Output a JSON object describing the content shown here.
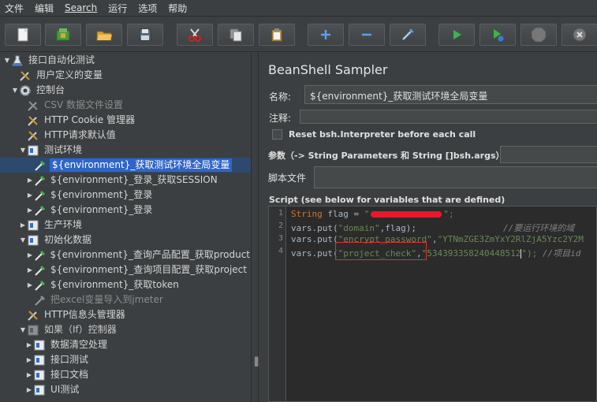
{
  "menu": {
    "file": "文件",
    "edit": "编辑",
    "search": "Search",
    "run": "运行",
    "options": "选项",
    "help": "帮助"
  },
  "tree": [
    {
      "label": "接口自动化测试"
    },
    {
      "label": "用户定义的变量"
    },
    {
      "label": "控制台"
    },
    {
      "label": "CSV 数据文件设置"
    },
    {
      "label": "HTTP Cookie 管理器"
    },
    {
      "label": "HTTP请求默认值"
    },
    {
      "label": "测试环境"
    },
    {
      "label": "${environment}_获取测试环境全局变量"
    },
    {
      "label": "${environment}_登录_获取SESSION"
    },
    {
      "label": "${environment}_登录"
    },
    {
      "label": "${environment}_登录"
    },
    {
      "label": "生产环境"
    },
    {
      "label": "初始化数据"
    },
    {
      "label": "${environment}_查询产品配置_获取product"
    },
    {
      "label": "${environment}_查询项目配置_获取project"
    },
    {
      "label": "${environment}_获取token"
    },
    {
      "label": "把excel变量导入到jmeter"
    },
    {
      "label": "HTTP信息头管理器"
    },
    {
      "label": "如果（If）控制器"
    },
    {
      "label": "数据清空处理"
    },
    {
      "label": "接口测试"
    },
    {
      "label": "接口文档"
    },
    {
      "label": "UI测试"
    }
  ],
  "panel": {
    "title": "BeanShell Sampler",
    "name_label": "名称:",
    "name_value": "${environment}_获取测试环境全局变量",
    "comment_label": "注释:",
    "reset_label": "Reset bsh.Interpreter before each call",
    "params_label": "参数（-> String Parameters 和 String []bsh.args）",
    "script_file_label": "脚本文件",
    "script_label": "Script (see below for variables that are defined)"
  },
  "code": {
    "lines": [
      "1",
      "2",
      "3",
      "4"
    ],
    "l1_kw": "String",
    "l1_a": " flag = ",
    "l1_str": "\"",
    "l1_end": "\";",
    "l2_a": "vars.put(",
    "l2_s1": "\"domain\"",
    "l2_b": ",flag);",
    "l2_cm": "//要运行环境的域",
    "l3_a": "vars.put(",
    "l3_s1": "\"encrypt_password\"",
    "l3_b": ",",
    "l3_s2": "\"YTNmZGE3ZmYxY2RlZjA5Yzc2Y2M",
    "l4_a": "vars.put(",
    "l4_s1": "\"project_check\"",
    "l4_b": ",",
    "l4_s2": "\"534393358240448512",
    "l4_c": "\");",
    "l4_cm": " //项目id"
  },
  "colors": {
    "bg": "#3c3f41",
    "selection": "#2f65ca",
    "editor": "#2b2b2b",
    "annotation": "#e03030",
    "redact": "#e8182a"
  }
}
